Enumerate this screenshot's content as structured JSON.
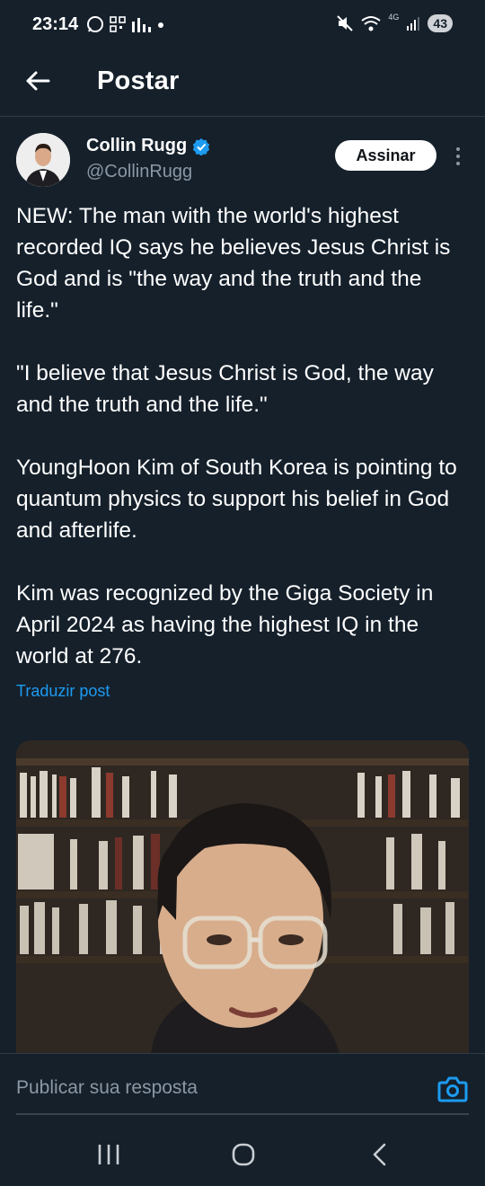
{
  "status_bar": {
    "time": "23:14",
    "network_label": "4G",
    "battery": "43",
    "left_icons": [
      "whatsapp-icon",
      "qr-icon",
      "signal-bars-icon",
      "dot-icon"
    ],
    "right_icons": [
      "mute-icon",
      "wifi-icon",
      "cell-signal-icon"
    ]
  },
  "header": {
    "back_icon": "arrow-left-icon",
    "title": "Postar"
  },
  "author": {
    "name": "Collin Rugg",
    "handle": "@CollinRugg",
    "verified": true,
    "verified_color": "#1d9bf0"
  },
  "actions": {
    "subscribe_label": "Assinar",
    "more_icon": "more-vertical-icon"
  },
  "post": {
    "paragraphs": [
      "NEW: The man with the world's highest recorded IQ says he believes Jesus Christ is God and is \"the way and the truth and the life.\"",
      "\"I believe that Jesus Christ is God, the way and the truth and the life.\"",
      "YoungHoon Kim of South Korea is pointing to quantum physics to support his belief in God and afterlife.",
      "Kim was recognized by the Giga Society in April 2024 as having the highest IQ in the world at 276."
    ],
    "translate_label": "Traduzir post",
    "media_description_icon": "video-thumbnail"
  },
  "reply": {
    "placeholder": "Publicar sua resposta",
    "camera_icon": "camera-icon"
  },
  "nav": {
    "recents_icon": "recents-icon",
    "home_icon": "home-circle-icon",
    "back_icon": "chevron-left-icon"
  },
  "colors": {
    "background": "#15202b",
    "accent": "#1d9bf0",
    "secondary_text": "#8b98a5"
  }
}
